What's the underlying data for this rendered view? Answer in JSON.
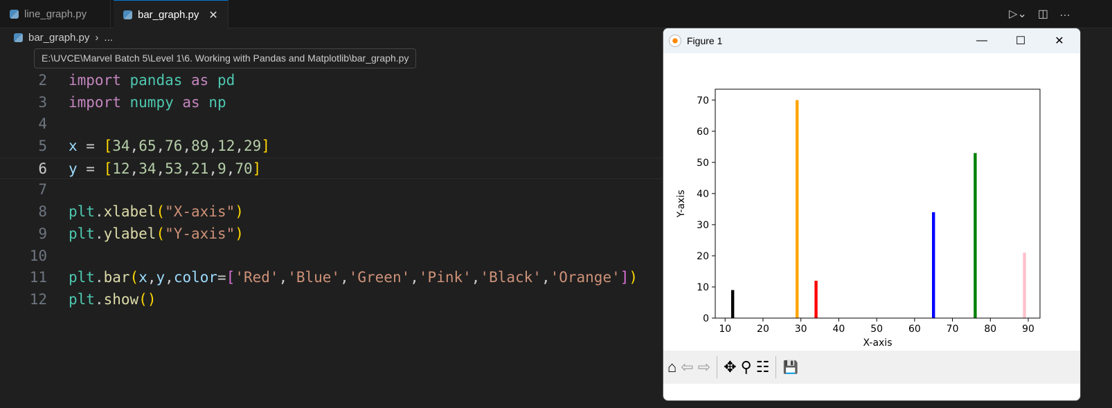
{
  "tabs": [
    {
      "label": "line_graph.py",
      "active": false
    },
    {
      "label": "bar_graph.py",
      "active": true
    }
  ],
  "breadcrumb": {
    "file": "bar_graph.py",
    "sep": "›",
    "more": "..."
  },
  "tooltip": "E:\\UVCE\\Marvel Batch 5\\Level 1\\6. Working with Pandas and Matplotlib\\bar_graph.py",
  "code_lines": [
    {
      "n": "2",
      "tokens": [
        [
          "kw",
          "import "
        ],
        [
          "mod",
          "pandas "
        ],
        [
          "kw",
          "as "
        ],
        [
          "mod",
          "pd"
        ]
      ]
    },
    {
      "n": "3",
      "tokens": [
        [
          "kw",
          "import "
        ],
        [
          "mod",
          "numpy "
        ],
        [
          "kw",
          "as "
        ],
        [
          "mod",
          "np"
        ]
      ]
    },
    {
      "n": "4",
      "tokens": []
    },
    {
      "n": "5",
      "tokens": [
        [
          "var",
          "x"
        ],
        [
          "",
          "  = "
        ],
        [
          "br",
          "["
        ],
        [
          "num",
          "34"
        ],
        [
          "",
          ","
        ],
        [
          "num",
          "65"
        ],
        [
          "",
          ","
        ],
        [
          "num",
          "76"
        ],
        [
          "",
          ","
        ],
        [
          "num",
          "89"
        ],
        [
          "",
          ","
        ],
        [
          "num",
          "12"
        ],
        [
          "",
          ","
        ],
        [
          "num",
          "29"
        ],
        [
          "br",
          "]"
        ]
      ]
    },
    {
      "n": "6",
      "tokens": [
        [
          "var",
          "y"
        ],
        [
          "",
          "  = "
        ],
        [
          "br",
          "["
        ],
        [
          "num",
          "12"
        ],
        [
          "",
          ","
        ],
        [
          "num",
          "34"
        ],
        [
          "",
          ","
        ],
        [
          "num",
          "53"
        ],
        [
          "",
          ","
        ],
        [
          "num",
          "21"
        ],
        [
          "",
          ","
        ],
        [
          "num",
          "9"
        ],
        [
          "",
          ","
        ],
        [
          "num",
          "70"
        ],
        [
          "br",
          "]"
        ]
      ]
    },
    {
      "n": "7",
      "tokens": []
    },
    {
      "n": "8",
      "tokens": [
        [
          "mod",
          "plt"
        ],
        [
          "",
          "."
        ],
        [
          "fn",
          "xlabel"
        ],
        [
          "br",
          "("
        ],
        [
          "str",
          "\"X-axis\""
        ],
        [
          "br",
          ")"
        ]
      ]
    },
    {
      "n": "9",
      "tokens": [
        [
          "mod",
          "plt"
        ],
        [
          "",
          "."
        ],
        [
          "fn",
          "ylabel"
        ],
        [
          "br",
          "("
        ],
        [
          "str",
          "\"Y-axis\""
        ],
        [
          "br",
          ")"
        ]
      ]
    },
    {
      "n": "10",
      "tokens": []
    },
    {
      "n": "11",
      "tokens": [
        [
          "mod",
          "plt"
        ],
        [
          "",
          "."
        ],
        [
          "fn",
          "bar"
        ],
        [
          "br",
          "("
        ],
        [
          "var",
          "x"
        ],
        [
          "",
          ","
        ],
        [
          "var",
          "y"
        ],
        [
          "",
          ","
        ],
        [
          "var",
          "color"
        ],
        [
          "",
          "="
        ],
        [
          "br2",
          "["
        ],
        [
          "str",
          "'Red'"
        ],
        [
          "",
          ","
        ],
        [
          "str",
          "'Blue'"
        ],
        [
          "",
          ","
        ],
        [
          "str",
          "'Green'"
        ],
        [
          "",
          ","
        ],
        [
          "str",
          "'Pink'"
        ],
        [
          "",
          ","
        ],
        [
          "str",
          "'Black'"
        ],
        [
          "",
          ","
        ],
        [
          "str",
          "'Orange'"
        ],
        [
          "br2",
          "]"
        ],
        [
          "br",
          ")"
        ]
      ]
    },
    {
      "n": "12",
      "tokens": [
        [
          "mod",
          "plt"
        ],
        [
          "",
          "."
        ],
        [
          "fn",
          "show"
        ],
        [
          "br",
          "()"
        ]
      ]
    }
  ],
  "current_line": "6",
  "figure": {
    "title": "Figure 1",
    "minimize": "—",
    "maximize": "☐",
    "close": "✕"
  },
  "toolbar": {
    "home": "⌂",
    "back": "⇦",
    "forward": "⇨",
    "pan": "✥",
    "zoom": "⚲",
    "configure": "☷",
    "save": "💾"
  },
  "chart_data": {
    "type": "bar",
    "x": [
      34,
      65,
      76,
      89,
      12,
      29
    ],
    "y": [
      12,
      34,
      53,
      21,
      9,
      70
    ],
    "colors": [
      "#ff0000",
      "#0000ff",
      "#008000",
      "#ffc0cb",
      "#000000",
      "#ffa500"
    ],
    "bar_width": 0.8,
    "xlabel": "X-axis",
    "ylabel": "Y-axis",
    "xlim": [
      7.4,
      93.1
    ],
    "ylim": [
      0,
      73.5
    ],
    "xticks": [
      10,
      20,
      30,
      40,
      50,
      60,
      70,
      80,
      90
    ],
    "yticks": [
      0,
      10,
      20,
      30,
      40,
      50,
      60,
      70
    ]
  }
}
